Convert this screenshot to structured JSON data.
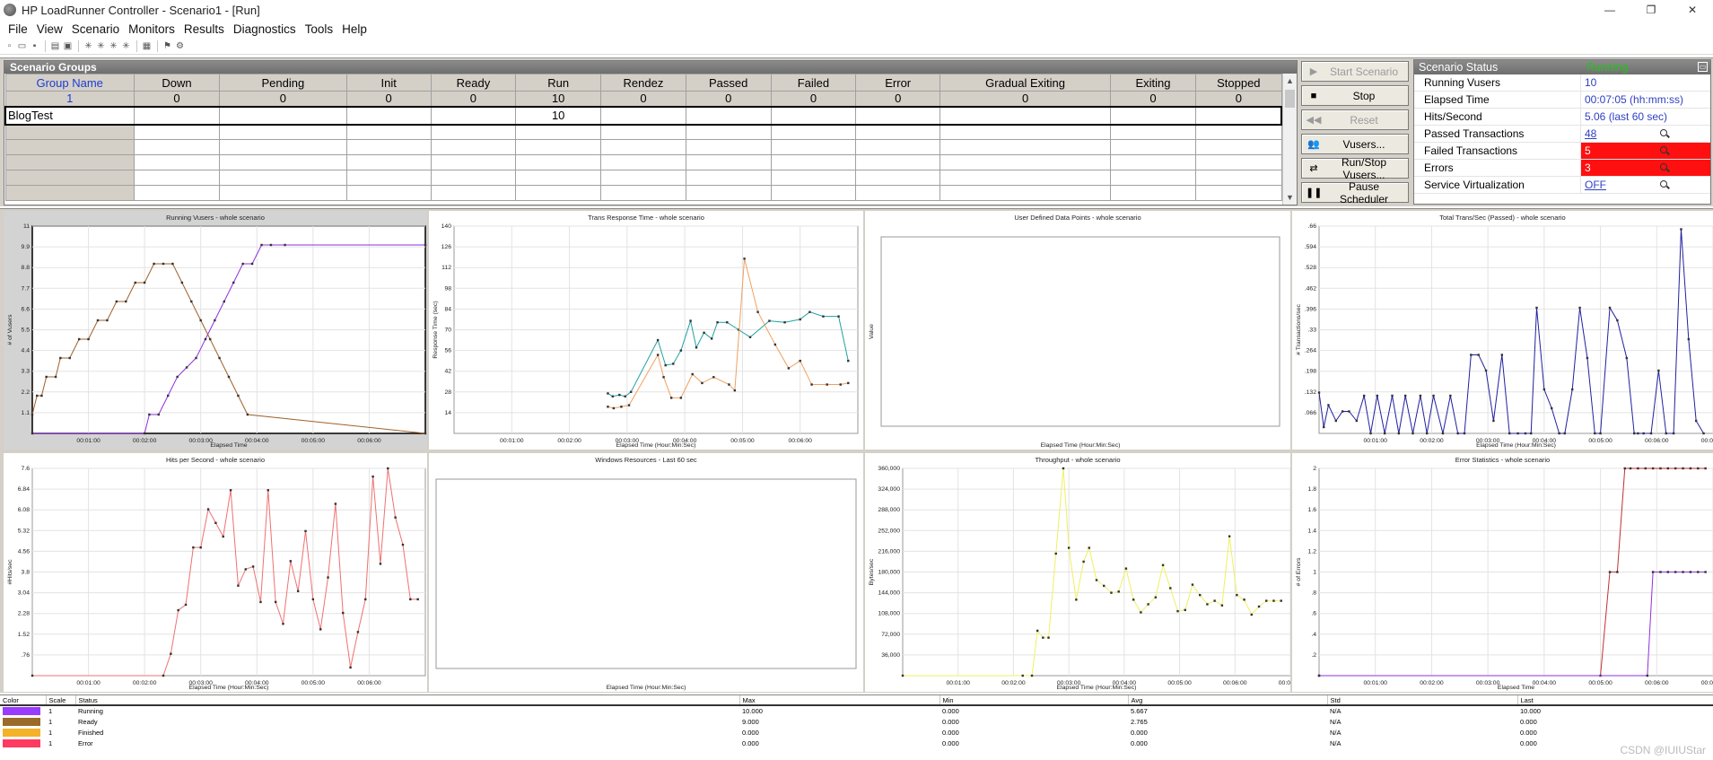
{
  "titlebar": {
    "title": "HP LoadRunner Controller - Scenario1 - [Run]",
    "minimize": "—",
    "restore": "❐",
    "close": "✕"
  },
  "menu": [
    "File",
    "View",
    "Scenario",
    "Monitors",
    "Results",
    "Diagnostics",
    "Tools",
    "Help"
  ],
  "scenario_groups": {
    "title": "Scenario Groups",
    "columns": [
      "Group Name",
      "Down",
      "Pending",
      "Init",
      "Ready",
      "Run",
      "Rendez",
      "Passed",
      "Failed",
      "Error",
      "Gradual Exiting",
      "Exiting",
      "Stopped"
    ],
    "totals": [
      "1",
      "0",
      "0",
      "0",
      "0",
      "10",
      "0",
      "0",
      "0",
      "0",
      "0",
      "0",
      "0"
    ],
    "groups": [
      [
        "BlogTest",
        "",
        "",
        "",
        "",
        "10",
        "",
        "",
        "",
        "",
        "",
        "",
        ""
      ]
    ]
  },
  "controls": {
    "start": "Start Scenario",
    "stop": "Stop",
    "reset": "Reset",
    "vusers": "Vusers...",
    "run_stop": "Run/Stop Vusers...",
    "pause": "Pause Scheduler"
  },
  "status": {
    "title": "Scenario Status",
    "state": "Running",
    "rows": [
      {
        "label": "Running Vusers",
        "value": "10"
      },
      {
        "label": "Elapsed Time",
        "value": "00:07:05 (hh:mm:ss)"
      },
      {
        "label": "Hits/Second",
        "value": "5.06 (last 60 sec)"
      },
      {
        "label": "Passed Transactions",
        "value": "48"
      },
      {
        "label": "Failed Transactions",
        "value": "5"
      },
      {
        "label": "Errors",
        "value": "3"
      },
      {
        "label": "Service Virtualization",
        "value": "OFF"
      }
    ],
    "colors": {
      "running": "#22c41c",
      "alert": "#ff1010",
      "link": "#3040c0"
    }
  },
  "chart_data": [
    {
      "type": "line",
      "title": "Running Vusers - whole scenario",
      "xlabel": "Elapsed Time",
      "ylabel": "# of Vusers",
      "xticks": [
        "00:01:00",
        "00:02:00",
        "00:03:00",
        "00:04:00",
        "00:05:00",
        "00:06:00"
      ],
      "yticks": [
        "1.1",
        "2.2",
        "3.3",
        "4.4",
        "5.5",
        "6.6",
        "7.7",
        "8.8",
        "9.9",
        "11"
      ],
      "ylim": [
        0,
        11
      ],
      "xlim": [
        0,
        420
      ],
      "series": [
        {
          "color": "#9030e0",
          "x": [
            0,
            120,
            125,
            135,
            145,
            155,
            165,
            175,
            185,
            195,
            205,
            215,
            225,
            235,
            245,
            255,
            270,
            420
          ],
          "y": [
            0,
            0,
            1,
            1,
            2,
            3,
            3.5,
            4,
            5,
            6,
            7,
            8,
            9,
            9,
            10,
            10,
            10,
            10
          ]
        },
        {
          "color": "#a0602a",
          "x": [
            0,
            5,
            10,
            15,
            25,
            30,
            40,
            50,
            60,
            70,
            80,
            90,
            100,
            110,
            120,
            130,
            140,
            150,
            160,
            170,
            180,
            190,
            200,
            210,
            220,
            230,
            420
          ],
          "y": [
            1,
            2,
            2,
            3,
            3,
            4,
            4,
            5,
            5,
            6,
            6,
            7,
            7,
            8,
            8,
            9,
            9,
            9,
            8,
            7,
            6,
            5,
            4,
            3,
            2,
            1,
            0
          ]
        }
      ]
    },
    {
      "type": "line",
      "title": "Trans Response Time - whole scenario",
      "xlabel": "Elapsed Time (Hour:Min:Sec)",
      "ylabel": "Response Time (sec)",
      "xticks": [
        "00:01:00",
        "00:02:00",
        "00:03:00",
        "00:04:00",
        "00:05:00",
        "00:06:00"
      ],
      "yticks": [
        "14",
        "28",
        "42",
        "56",
        "70",
        "84",
        "98",
        "112",
        "126",
        "140"
      ],
      "ylim": [
        0,
        140
      ],
      "xlim": [
        0,
        420
      ],
      "series": [
        {
          "color": "#20a0a0",
          "x": [
            160,
            165,
            172,
            178,
            184,
            212,
            220,
            228,
            236,
            246,
            252,
            260,
            268,
            274,
            284,
            296,
            308,
            328,
            344,
            360,
            370,
            384,
            400,
            410
          ],
          "y": [
            27,
            25,
            26,
            25,
            28,
            63,
            46,
            47,
            56,
            76,
            58,
            68,
            64,
            75,
            75,
            70,
            65,
            76,
            75,
            77,
            82,
            79,
            79,
            49
          ]
        },
        {
          "color": "#f0a060",
          "x": [
            160,
            166,
            174,
            182,
            212,
            218,
            226,
            236,
            248,
            258,
            270,
            286,
            292,
            302,
            316,
            334,
            348,
            360,
            372,
            388,
            402,
            410
          ],
          "y": [
            18,
            17,
            18,
            19,
            53,
            38,
            24,
            24,
            40,
            34,
            38,
            33,
            29,
            118,
            82,
            60,
            44,
            49,
            33,
            33,
            33,
            34
          ]
        }
      ]
    },
    {
      "type": "line",
      "title": "User Defined Data Points - whole scenario",
      "xlabel": "Elapsed Time (Hour:Min:Sec)",
      "ylabel": "Value",
      "series": []
    },
    {
      "type": "line",
      "title": "Total Trans/Sec (Passed) - whole scenario",
      "xlabel": "Elapsed Time (Hour:Min:Sec)",
      "ylabel": "# Transactions/sec",
      "xticks": [
        "00:01:00",
        "00:02:00",
        "00:03:00",
        "00:04:00",
        "00:05:00",
        "00:06:00",
        "00:07:00"
      ],
      "yticks": [
        ".066",
        ".132",
        ".198",
        ".264",
        ".33",
        ".396",
        ".462",
        ".528",
        ".594",
        ".66"
      ],
      "ylim": [
        0,
        0.66
      ],
      "xlim": [
        0,
        420
      ],
      "series": [
        {
          "color": "#2020a0",
          "x": [
            0,
            5,
            10,
            18,
            25,
            32,
            40,
            48,
            55,
            62,
            70,
            78,
            85,
            92,
            100,
            108,
            115,
            122,
            132,
            140,
            148,
            155,
            162,
            170,
            178,
            186,
            195,
            203,
            212,
            220,
            226,
            232,
            240,
            248,
            256,
            262,
            270,
            278,
            286,
            294,
            300,
            310,
            318,
            328,
            336,
            340,
            346,
            354,
            362,
            370,
            378,
            386,
            394,
            402,
            410
          ],
          "y": [
            0.13,
            0.02,
            0.09,
            0.04,
            0.07,
            0.07,
            0.04,
            0.12,
            0,
            0.12,
            0,
            0.12,
            0,
            0.12,
            0,
            0.12,
            0,
            0.12,
            0,
            0.12,
            0,
            0,
            0.25,
            0.25,
            0.2,
            0.04,
            0.25,
            0,
            0,
            0,
            0,
            0.4,
            0.14,
            0.08,
            0,
            0,
            0.14,
            0.4,
            0.24,
            0,
            0,
            0.4,
            0.36,
            0.24,
            0,
            0,
            0,
            0,
            0.2,
            0,
            0,
            0.65,
            0.3,
            0.04,
            0
          ]
        }
      ]
    },
    {
      "type": "line",
      "title": "Hits per Second - whole scenario",
      "xlabel": "Elapsed Time (Hour:Min:Sec)",
      "ylabel": "#Hits/sec",
      "xticks": [
        "00:01:00",
        "00:02:00",
        "00:03:00",
        "00:04:00",
        "00:05:00",
        "00:06:00"
      ],
      "yticks": [
        ".76",
        "1.52",
        "2.28",
        "3.04",
        "3.8",
        "4.56",
        "5.32",
        "6.08",
        "6.84",
        "7.6"
      ],
      "ylim": [
        0,
        7.6
      ],
      "xlim": [
        0,
        420
      ],
      "series": [
        {
          "color": "#f07070",
          "x": [
            0,
            140,
            148,
            156,
            164,
            172,
            180,
            188,
            196,
            204,
            212,
            220,
            228,
            236,
            244,
            252,
            260,
            268,
            276,
            284,
            292,
            300,
            308,
            316,
            324,
            332,
            340,
            348,
            356,
            364,
            372,
            380,
            388,
            396,
            404,
            412
          ],
          "y": [
            0,
            0,
            0.8,
            2.4,
            2.6,
            4.7,
            4.7,
            6.1,
            5.6,
            5.1,
            6.8,
            3.3,
            3.9,
            4.0,
            2.7,
            6.8,
            2.7,
            1.9,
            4.2,
            3.1,
            5.3,
            2.8,
            1.7,
            3.6,
            6.3,
            2.3,
            0.3,
            1.6,
            2.8,
            7.3,
            4.1,
            7.6,
            5.8,
            4.8,
            2.8,
            2.8
          ]
        }
      ]
    },
    {
      "type": "line",
      "title": "Windows Resources - Last 60 sec",
      "xlabel": "Elapsed Time (Hour:Min:Sec)",
      "ylabel": "",
      "series": []
    },
    {
      "type": "line",
      "title": "Throughput - whole scenario",
      "xlabel": "Elapsed Time (Hour:Min:Sec)",
      "ylabel": "Bytes/sec",
      "xticks": [
        "00:01:00",
        "00:02:00",
        "00:03:00",
        "00:04:00",
        "00:05:00",
        "00:06:00",
        "00:07:00"
      ],
      "yticks": [
        "36,000",
        "72,000",
        "108,000",
        "144,000",
        "180,000",
        "216,000",
        "252,000",
        "288,000",
        "324,000",
        "360,000"
      ],
      "ylim": [
        0,
        360000
      ],
      "xlim": [
        0,
        420
      ],
      "series": [
        {
          "color": "#f0f060",
          "x": [
            0,
            130,
            140,
            146,
            152,
            158,
            166,
            174,
            180,
            188,
            196,
            202,
            210,
            218,
            226,
            234,
            242,
            250,
            258,
            266,
            274,
            282,
            290,
            298,
            306,
            314,
            322,
            330,
            338,
            346,
            354,
            362,
            370,
            378,
            386,
            394,
            402,
            410
          ],
          "y": [
            0,
            0,
            0,
            78000,
            66000,
            66000,
            212000,
            360000,
            222000,
            132000,
            198000,
            222000,
            166000,
            156000,
            144000,
            146000,
            186000,
            132000,
            110000,
            124000,
            136000,
            192000,
            152000,
            112000,
            114000,
            158000,
            140000,
            124000,
            130000,
            122000,
            242000,
            140000,
            132000,
            106000,
            120000,
            130000,
            130000,
            130000
          ]
        }
      ]
    },
    {
      "type": "line",
      "title": "Error Statistics - whole scenario",
      "xlabel": "Elapsed Time",
      "ylabel": "# of Errors",
      "xticks": [
        "00:01:00",
        "00:02:00",
        "00:03:00",
        "00:04:00",
        "00:05:00",
        "00:06:00",
        "00:07:00"
      ],
      "yticks": [
        ".2",
        ".4",
        ".6",
        ".8",
        "1",
        "1.2",
        "1.4",
        "1.6",
        "1.8",
        "2"
      ],
      "ylim": [
        0,
        2
      ],
      "xlim": [
        0,
        420
      ],
      "series": [
        {
          "color": "#c03030",
          "x": [
            0,
            300,
            310,
            318,
            326,
            332,
            340,
            348,
            356,
            364,
            372,
            380,
            388,
            396,
            404,
            412
          ],
          "y": [
            0,
            0,
            1,
            1,
            2,
            2,
            2,
            2,
            2,
            2,
            2,
            2,
            2,
            2,
            2,
            2
          ]
        },
        {
          "color": "#9030e0",
          "x": [
            0,
            350,
            356,
            364,
            372,
            380,
            388,
            396,
            404,
            412
          ],
          "y": [
            0,
            0,
            1,
            1,
            1,
            1,
            1,
            1,
            1,
            1
          ]
        }
      ]
    }
  ],
  "legend": {
    "columns": [
      "Color",
      "Scale",
      "Status",
      "Max",
      "Min",
      "Avg",
      "Std",
      "Last"
    ],
    "rows": [
      {
        "color": "#9a3cff",
        "scale": "1",
        "status": "Running",
        "max": "10.000",
        "min": "0.000",
        "avg": "5.667",
        "std": "N/A",
        "last": "10.000"
      },
      {
        "color": "#9a6a2a",
        "scale": "1",
        "status": "Ready",
        "max": "9.000",
        "min": "0.000",
        "avg": "2.765",
        "std": "N/A",
        "last": "0.000"
      },
      {
        "color": "#f4b228",
        "scale": "1",
        "status": "Finished",
        "max": "0.000",
        "min": "0.000",
        "avg": "0.000",
        "std": "N/A",
        "last": "0.000"
      },
      {
        "color": "#ff3a60",
        "scale": "1",
        "status": "Error",
        "max": "0.000",
        "min": "0.000",
        "avg": "0.000",
        "std": "N/A",
        "last": "0.000"
      }
    ]
  },
  "watermark": "CSDN @IUIUStar"
}
